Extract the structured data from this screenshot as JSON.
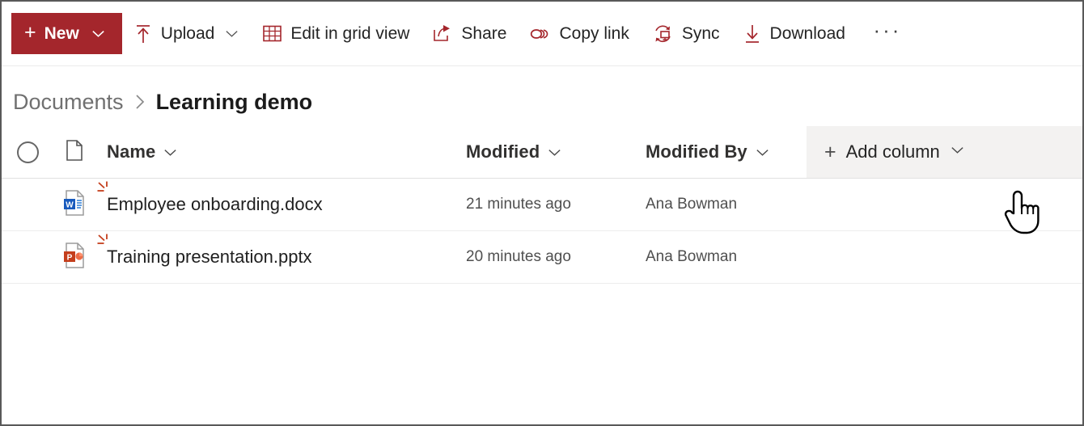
{
  "toolbar": {
    "new_button": {
      "label": "New",
      "plus": "+",
      "icon": "chevron-down-icon",
      "color": "#a4262c"
    },
    "items": [
      {
        "label": "Upload",
        "icon": "upload-icon",
        "has_chevron": true
      },
      {
        "label": "Edit in grid view",
        "icon": "grid-view-icon",
        "has_chevron": false
      },
      {
        "label": "Share",
        "icon": "share-icon",
        "has_chevron": false
      },
      {
        "label": "Copy link",
        "icon": "link-icon",
        "has_chevron": false
      },
      {
        "label": "Sync",
        "icon": "sync-icon",
        "has_chevron": false
      },
      {
        "label": "Download",
        "icon": "download-icon",
        "has_chevron": false
      }
    ],
    "overflow": {
      "label": "···",
      "icon": "more-ellipsis-icon"
    }
  },
  "breadcrumb": {
    "root": "Documents",
    "separator": "›",
    "current": "Learning demo"
  },
  "list": {
    "headers": {
      "select_all": "select-all-circle",
      "file_type": "file-type-icon",
      "name": "Name",
      "modified": "Modified",
      "modified_by": "Modified By",
      "add_column": "Add column",
      "add_column_plus": "+"
    },
    "rows": [
      {
        "icon": "word-file-icon",
        "name": "Employee onboarding.docx",
        "modified": "21 minutes ago",
        "modified_by": "Ana Bowman",
        "is_new": true
      },
      {
        "icon": "powerpoint-file-icon",
        "name": "Training presentation.pptx",
        "modified": "20 minutes ago",
        "modified_by": "Ana Bowman",
        "is_new": true
      }
    ]
  },
  "cursor": {
    "type": "pointing-hand-cursor"
  },
  "colors": {
    "brand_red": "#a4262c",
    "icon_red": "#a4262c",
    "word_blue": "#185abd",
    "powerpoint_orange": "#c43e1c",
    "hover_grey": "#f3f2f1",
    "text_primary": "#242424",
    "text_secondary": "#707070"
  }
}
